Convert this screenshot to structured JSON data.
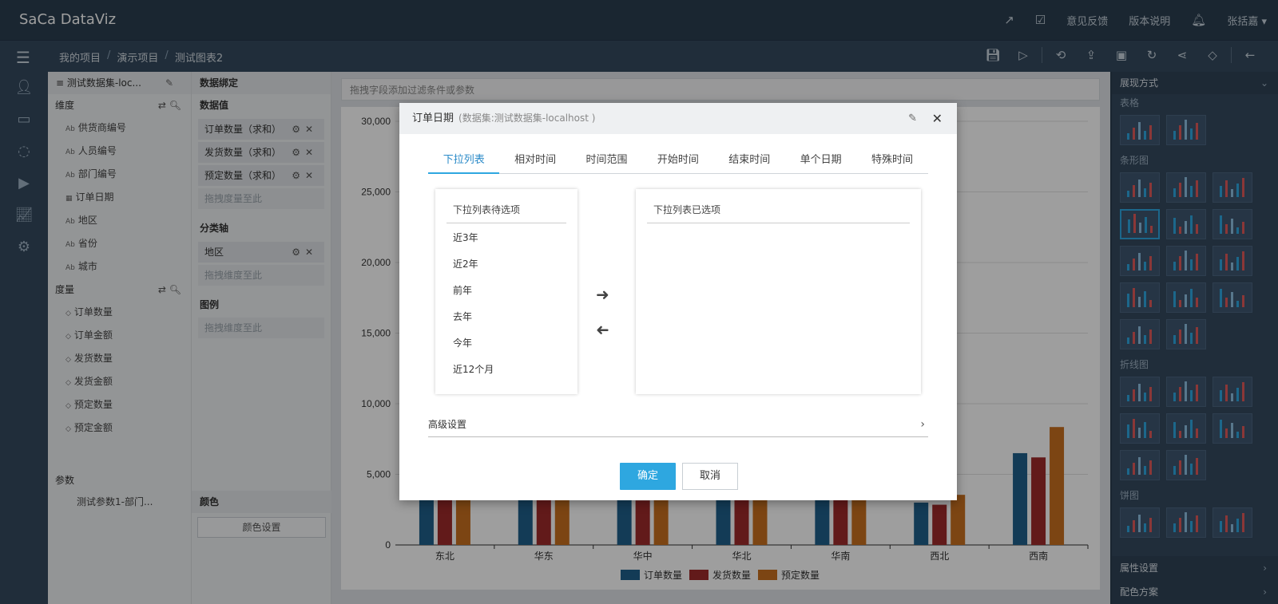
{
  "app": {
    "logo": "SaCa DataViz"
  },
  "topbar": {
    "feedback": "意见反馈",
    "release_notes": "版本说明",
    "user": "张括嘉 ▾"
  },
  "breadcrumb": {
    "items": [
      "我的项目",
      "演示项目",
      "测试图表2"
    ],
    "separator": "/"
  },
  "dimension_panel": {
    "dataset": "测试数据集-loc...",
    "dimension_title": "维度",
    "dimensions": [
      "供货商编号",
      "人员编号",
      "部门编号",
      "订单日期",
      "地区",
      "省份",
      "城市"
    ],
    "measure_title": "度量",
    "measures": [
      "订单数量",
      "订单金额",
      "发货数量",
      "发货金额",
      "预定数量",
      "预定金额"
    ],
    "param_title": "参数",
    "params": [
      "测试参数1-部门..."
    ]
  },
  "binding_panel": {
    "title": "数据绑定",
    "values_title": "数据值",
    "values": [
      "订单数量（求和）",
      "发货数量（求和）",
      "预定数量（求和）"
    ],
    "values_drop": "拖拽度量至此",
    "axis_title": "分类轴",
    "axis": [
      "地区"
    ],
    "axis_drop": "拖拽维度至此",
    "legend_title": "图例",
    "legend_drop": "拖拽维度至此",
    "color_title": "颜色",
    "color_button": "颜色设置"
  },
  "chart_area": {
    "filter_placeholder": "拖拽字段添加过滤条件或参数"
  },
  "chart_data": {
    "type": "bar",
    "categories": [
      "东北",
      "华东",
      "华中",
      "华北",
      "华南",
      "西北",
      "西南"
    ],
    "series": [
      {
        "name": "订单数量",
        "color": "#1f5f8b",
        "values": [
          4200,
          4300,
          3300,
          4000,
          4200,
          3000,
          6500
        ]
      },
      {
        "name": "发货数量",
        "color": "#9e2b2b",
        "values": [
          4000,
          4100,
          3150,
          3900,
          4000,
          2850,
          6200
        ]
      },
      {
        "name": "预定数量",
        "color": "#c87020",
        "values": [
          4600,
          4600,
          4300,
          4500,
          4700,
          3550,
          8350
        ]
      }
    ],
    "ylim": [
      0,
      30000
    ],
    "yticks": [
      "0",
      "5,000",
      "10,000",
      "15,000",
      "20,000",
      "25,000",
      "30,000"
    ],
    "legend": "bottom",
    "grid": true
  },
  "right_panel": {
    "title": "展现方式",
    "sections": [
      "表格",
      "条形图",
      "折线图",
      "饼图"
    ],
    "footer1": "属性设置",
    "footer2": "配色方案"
  },
  "modal": {
    "title": "订单日期",
    "subtitle": "(数据集:测试数据集-localhost )",
    "tabs": [
      "下拉列表",
      "相对时间",
      "时间范围",
      "开始时间",
      "结束时间",
      "单个日期",
      "特殊时间"
    ],
    "available_title": "下拉列表待选项",
    "available_items": [
      "近3年",
      "近2年",
      "前年",
      "去年",
      "今年",
      "近12个月"
    ],
    "selected_title": "下拉列表已选项",
    "advanced": "高级设置",
    "ok": "确定",
    "cancel": "取消"
  },
  "colors": {
    "accent": "#2ea7e0",
    "topbar": "#2b3e50"
  }
}
